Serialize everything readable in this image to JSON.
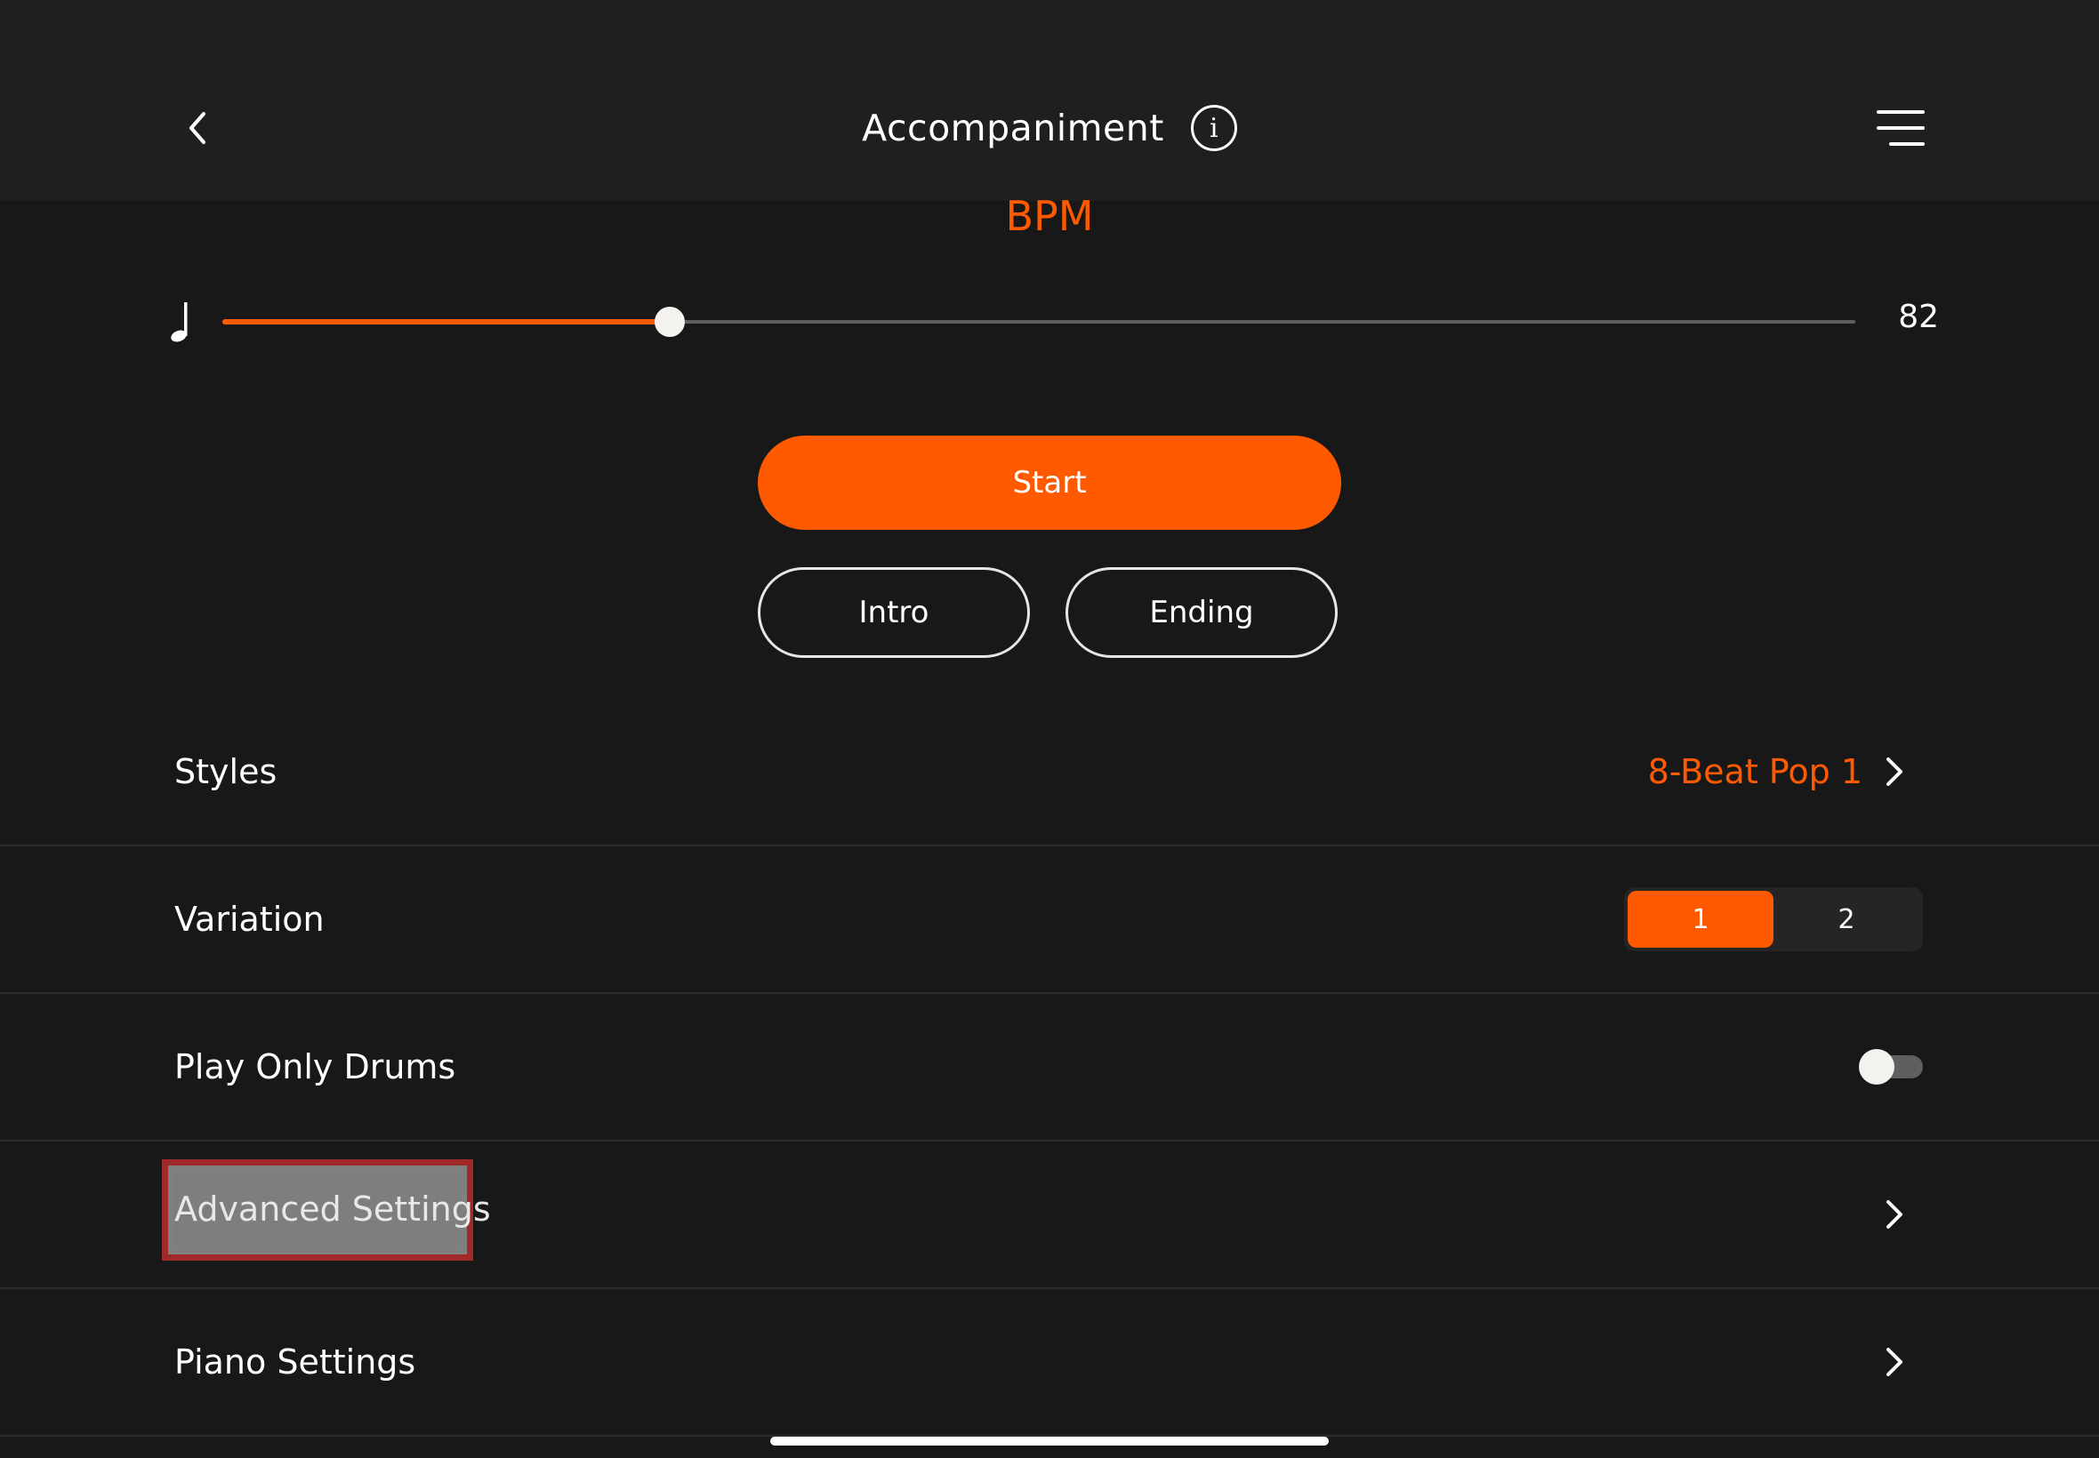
{
  "header": {
    "title": "Accompaniment",
    "info_glyph": "i",
    "back_icon": "chevron-left-icon",
    "menu_icon": "hamburger-menu-icon"
  },
  "tempo": {
    "label": "BPM",
    "value": "82",
    "slider_fraction": 0.274,
    "note_icon": "quarter-note-icon"
  },
  "controls": {
    "start_label": "Start",
    "intro_label": "Intro",
    "ending_label": "Ending"
  },
  "settings": {
    "styles": {
      "label": "Styles",
      "value": "8-Beat Pop 1"
    },
    "variation": {
      "label": "Variation",
      "options": [
        "1",
        "2"
      ],
      "selected": "1"
    },
    "play_only_drums": {
      "label": "Play Only Drums",
      "enabled": false
    },
    "advanced": {
      "label": "Advanced Settings"
    },
    "piano": {
      "label": "Piano Settings"
    }
  },
  "colors": {
    "accent": "#ff5a00",
    "background": "#181819",
    "header": "#1f1f20",
    "highlight_border": "#a02a2a"
  }
}
